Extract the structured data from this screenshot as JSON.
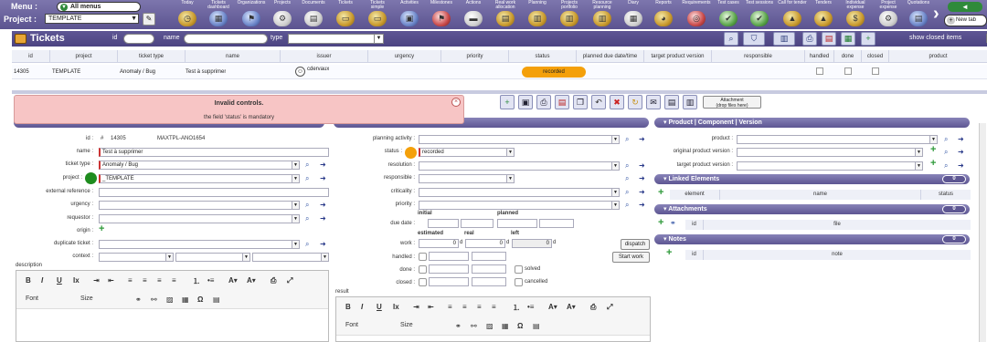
{
  "topbar": {
    "menu_label": "Menu :",
    "menu_value": "All menus",
    "project_label": "Project :",
    "project_value": "TEMPLATE",
    "items": [
      "Today",
      "Tickets dashboard",
      "Organizations",
      "Projects",
      "Documents",
      "Tickets",
      "Tickets simple",
      "Activities",
      "Milestones",
      "Actions",
      "Real work allocation",
      "Planning",
      "Projects portfolio",
      "Resource planning",
      "Diary",
      "Reports",
      "Requirements",
      "Test cases",
      "Test sessions",
      "Call for tender",
      "Tenders",
      "Individual expense",
      "Project expense",
      "Quotations"
    ],
    "back_label": "◄",
    "new_tab_label": "New tab"
  },
  "list": {
    "title": "Tickets",
    "filter_id_label": "id",
    "filter_name_label": "name",
    "filter_type_label": "type",
    "show_closed_label": "show closed items",
    "columns": [
      "id",
      "project",
      "ticket type",
      "name",
      "issuer",
      "urgency",
      "priority",
      "status",
      "planned due date/time",
      "target product version",
      "responsible",
      "handled",
      "done",
      "closed",
      "product"
    ],
    "rows": [
      {
        "id": "14305",
        "project": "TEMPLATE",
        "type": "Anomaly / Bug",
        "name": "Test à supprimer",
        "issuer": "cdervaux",
        "status": "recorded"
      }
    ]
  },
  "toolbar": {
    "attach_label_1": "Attachment",
    "attach_label_2": "(drop files here)"
  },
  "error": {
    "title": "Invalid controls.",
    "message": "the field 'status' is mandatory"
  },
  "desc": {
    "id_label": "id :",
    "id_hash": "#",
    "id_value": "14305",
    "ref": "MAXTPL-ANO1654",
    "name_label": "name :",
    "name_value": "Test à supprimer",
    "type_label": "ticket type :",
    "type_value": "Anomaly / Bug",
    "project_label": "project :",
    "project_value": "_TEMPLATE",
    "extref_label": "external reference :",
    "urgency_label": "urgency :",
    "requestor_label": "requestor :",
    "origin_label": "origin :",
    "dup_label": "duplicate ticket :",
    "context_label": "context :",
    "description_label": "description",
    "font_label": "Font",
    "size_label": "Size"
  },
  "treat": {
    "planning_label": "planning activity :",
    "status_label": "status :",
    "status_value": "recorded",
    "resolution_label": "resolution :",
    "responsible_label": "responsible :",
    "criticality_label": "criticality :",
    "priority_label": "priority :",
    "initial_label": "initial",
    "planned_label": "planned",
    "due_label": "due date :",
    "estimated_label": "estimated",
    "real_label": "real",
    "left_label": "left",
    "work_label": "work :",
    "est_value": "0",
    "real_value": "0",
    "left_value": "0",
    "unit": "d",
    "dispatch_label": "dispatch",
    "start_label": "Start work",
    "handled_label": "handled :",
    "done_label": "done :",
    "closed_label": "closed :",
    "solved_label": "solved",
    "cancelled_label": "cancelled",
    "result_label": "result",
    "font_label": "Font",
    "size_label": "Size"
  },
  "right": {
    "ppv_title": "Product | Component | Version",
    "product_label": "product :",
    "orig_label": "original product version :",
    "target_label": "target product version :",
    "linked_title": "Linked Elements",
    "linked_count": "0",
    "linked_cols": [
      "element",
      "name",
      "status"
    ],
    "attach_title": "Attachments",
    "attach_count": "0",
    "attach_cols": [
      "id",
      "file"
    ],
    "notes_title": "Notes",
    "notes_count": "0",
    "notes_cols": [
      "id",
      "note"
    ]
  }
}
